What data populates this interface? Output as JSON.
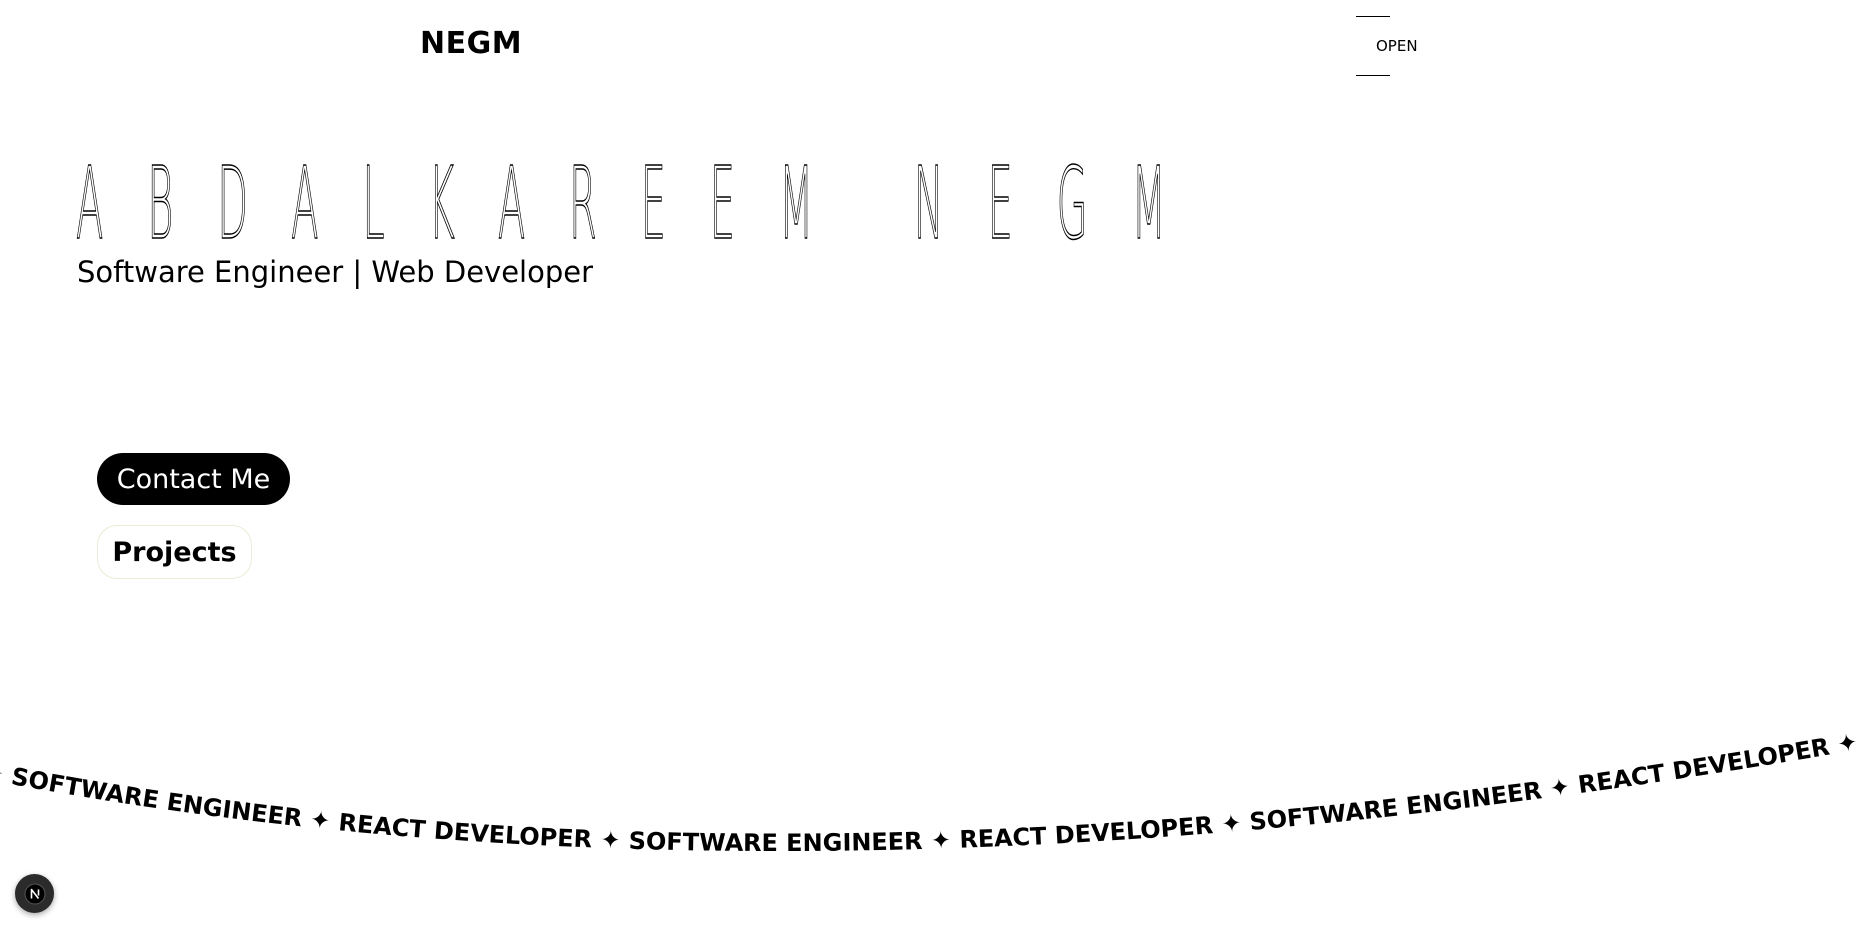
{
  "header": {
    "logo": "NEGM",
    "menu_label": "OPEN"
  },
  "hero": {
    "name": "ABDALKAREEM NEGM",
    "subtitle": "Software Engineer | Web Developer"
  },
  "buttons": {
    "contact_label": "Contact Me",
    "projects_label": "Projects"
  },
  "marquee": {
    "separator": "✦",
    "text": "ER ✦ SOFTWARE ENGINEER ✦ REACT DEVELOPER ✦ SOFTWARE ENGINEER ✦ REACT DEVELOPER ✦ SOFTWARE ENGINEER ✦ REACT DEVELOPER ✦ SOFTWA"
  },
  "dev_badge": {
    "icon": "nextjs-logo-icon",
    "letter": "N"
  },
  "colors": {
    "background": "#ffffff",
    "text": "#000000",
    "button_dark": "#000000",
    "button_outline": "#ebebd8",
    "badge": "#2b2b2b"
  }
}
